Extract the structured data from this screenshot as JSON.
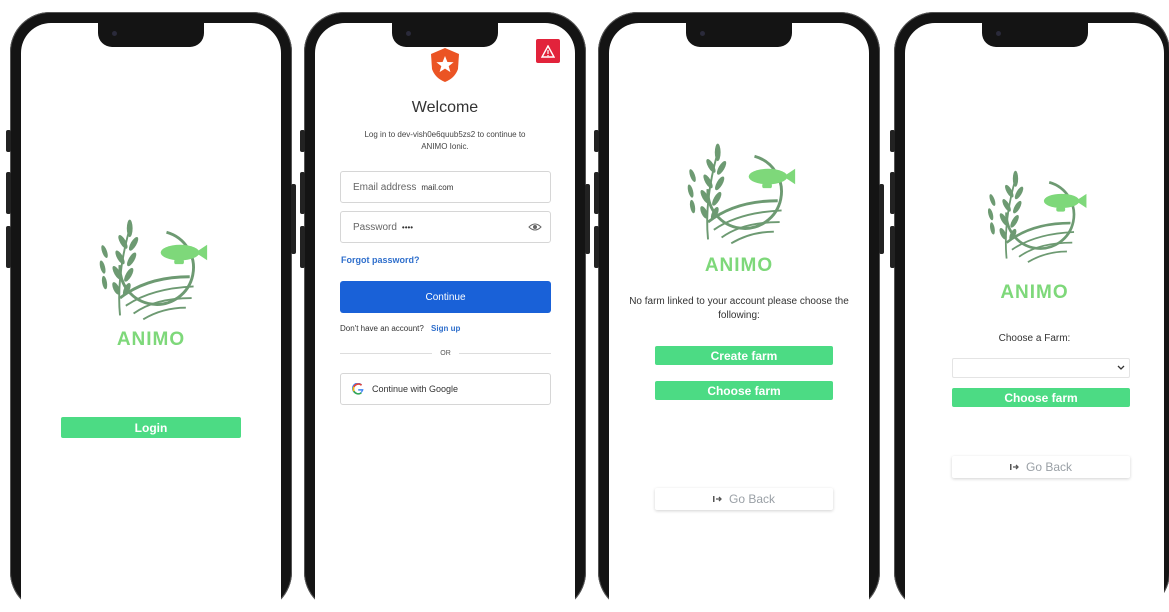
{
  "screen1": {
    "brand": "ANIMO",
    "login_label": "Login"
  },
  "screen2": {
    "welcome": "Welcome",
    "subtitle": "Log in to dev-vish0e6quub5zs2 to continue to ANIMO Ionic.",
    "email_placeholder": "Email address",
    "email_value": "mail.com",
    "password_placeholder": "Password",
    "password_value": "••••",
    "forgot": "Forgot password?",
    "continue_label": "Continue",
    "no_account": "Don't have an account?",
    "signup": "Sign up",
    "or": "OR",
    "google_label": "Continue with Google"
  },
  "screen3": {
    "brand": "ANIMO",
    "message": "No farm linked to your account please choose the following:",
    "create_label": "Create farm",
    "choose_label": "Choose farm",
    "back_label": "Go Back"
  },
  "screen4": {
    "brand": "ANIMO",
    "choose_prompt": "Choose a Farm:",
    "select_value": "",
    "choose_label": "Choose farm",
    "back_label": "Go Back"
  },
  "colors": {
    "accent_green": "#4cdb84",
    "logo_green": "#6d9a72",
    "brand_green": "#7ed87a",
    "primary_blue": "#1961d8",
    "warning_red": "#e2233b",
    "auth0_orange": "#eb5424"
  }
}
